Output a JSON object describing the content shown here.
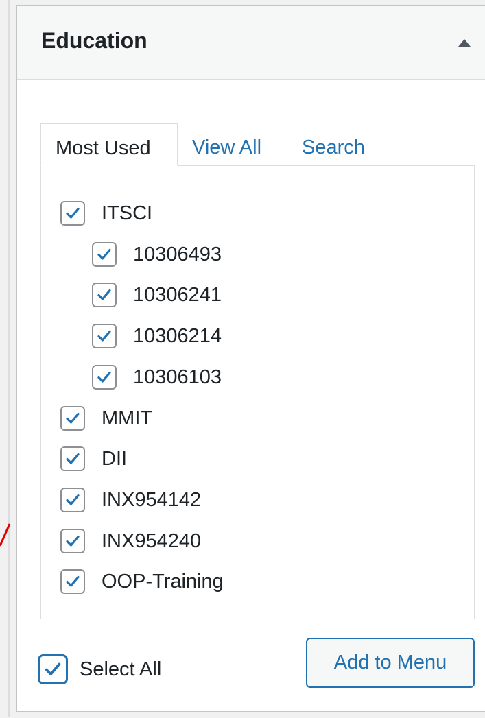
{
  "panel": {
    "title": "Education"
  },
  "tabs": [
    {
      "label": "Most Used"
    },
    {
      "label": "View All"
    },
    {
      "label": "Search"
    }
  ],
  "items": [
    {
      "label": "ITSCI",
      "checked": true,
      "level": 0
    },
    {
      "label": "10306493",
      "checked": true,
      "level": 1
    },
    {
      "label": "10306241",
      "checked": true,
      "level": 1
    },
    {
      "label": "10306214",
      "checked": true,
      "level": 1
    },
    {
      "label": "10306103",
      "checked": true,
      "level": 1
    },
    {
      "label": "MMIT",
      "checked": true,
      "level": 0
    },
    {
      "label": "DII",
      "checked": true,
      "level": 0
    },
    {
      "label": "INX954142",
      "checked": true,
      "level": 0
    },
    {
      "label": "INX954240",
      "checked": true,
      "level": 0
    },
    {
      "label": "OOP-Training",
      "checked": true,
      "level": 0
    }
  ],
  "footer": {
    "select_all_label": "Select All",
    "select_all_checked": true,
    "add_button_label": "Add to Menu"
  },
  "colors": {
    "accent": "#2271b1",
    "text": "#1d2327",
    "border": "#dcdcde",
    "annotation": "#e00000"
  },
  "icons": {
    "toggle": "triangle-up-icon",
    "checkbox": "checkmark-icon"
  }
}
